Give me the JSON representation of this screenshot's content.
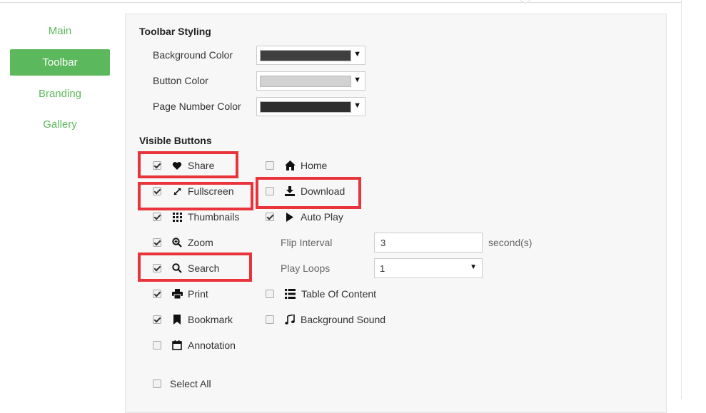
{
  "sidebar": {
    "items": [
      {
        "label": "Main",
        "active": false
      },
      {
        "label": "Toolbar",
        "active": true
      },
      {
        "label": "Branding",
        "active": false
      },
      {
        "label": "Gallery",
        "active": false
      }
    ]
  },
  "toolbar_styling": {
    "title": "Toolbar Styling",
    "background_color": {
      "label": "Background Color",
      "value": "#3f3f3f"
    },
    "button_color": {
      "label": "Button Color",
      "value": "#d2d2d2"
    },
    "page_number_color": {
      "label": "Page Number Color",
      "value": "#2f2f2f"
    },
    "dropdown_arrow": "▼"
  },
  "visible_buttons": {
    "title": "Visible Buttons",
    "left": [
      {
        "label": "Share",
        "checked": true,
        "icon": "heart-icon",
        "highlighted": true
      },
      {
        "label": "Fullscreen",
        "checked": true,
        "icon": "fullscreen-icon",
        "highlighted": true
      },
      {
        "label": "Thumbnails",
        "checked": true,
        "icon": "thumbnails-icon",
        "highlighted": false
      },
      {
        "label": "Zoom",
        "checked": true,
        "icon": "zoom-icon",
        "highlighted": false
      },
      {
        "label": "Search",
        "checked": true,
        "icon": "search-icon",
        "highlighted": true
      },
      {
        "label": "Print",
        "checked": true,
        "icon": "print-icon",
        "highlighted": false
      },
      {
        "label": "Bookmark",
        "checked": true,
        "icon": "bookmark-icon",
        "highlighted": false
      },
      {
        "label": "Annotation",
        "checked": false,
        "icon": "calendar-icon",
        "highlighted": false
      }
    ],
    "right": [
      {
        "label": "Home",
        "checked": false,
        "icon": "home-icon",
        "highlighted": false
      },
      {
        "label": "Download",
        "checked": false,
        "icon": "download-icon",
        "highlighted": true
      },
      {
        "label": "Auto Play",
        "checked": true,
        "icon": "play-icon",
        "highlighted": false
      },
      {
        "label": "Table Of Content",
        "checked": false,
        "icon": "list-icon",
        "highlighted": false
      },
      {
        "label": "Background Sound",
        "checked": false,
        "icon": "music-icon",
        "highlighted": false
      }
    ],
    "flip_interval": {
      "label": "Flip Interval",
      "value": "3",
      "unit": "second(s)"
    },
    "play_loops": {
      "label": "Play Loops",
      "value": "1"
    },
    "select_all": {
      "label": "Select All",
      "checked": false
    }
  },
  "colors": {
    "accent": "#5cb85c",
    "highlight": "#e8343a"
  }
}
